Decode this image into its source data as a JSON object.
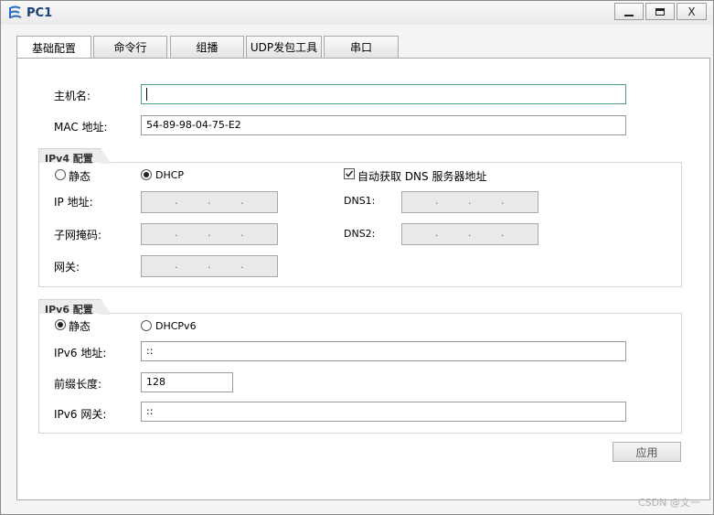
{
  "window": {
    "title": "PC1",
    "close_label": "X"
  },
  "tabs": [
    {
      "label": "基础配置"
    },
    {
      "label": "命令行"
    },
    {
      "label": "组播"
    },
    {
      "label": "UDP发包工具"
    },
    {
      "label": "串口"
    }
  ],
  "basic": {
    "hostname_label": "主机名:",
    "hostname_value": "",
    "mac_label": "MAC 地址:",
    "mac_value": "54-89-98-04-75-E2"
  },
  "ipv4": {
    "group_title": "IPv4 配置",
    "static_label": "静态",
    "dhcp_label": "DHCP",
    "auto_dns_label": "自动获取 DNS 服务器地址",
    "ip_label": "IP 地址:",
    "mask_label": "子网掩码:",
    "gateway_label": "网关:",
    "dns1_label": "DNS1:",
    "dns2_label": "DNS2:",
    "ip_dots": ".  .  .",
    "mode": "DHCP",
    "auto_dns_checked": true
  },
  "ipv6": {
    "group_title": "IPv6 配置",
    "static_label": "静态",
    "dhcp_label": "DHCPv6",
    "addr_label": "IPv6 地址:",
    "addr_value": "::",
    "prefix_label": "前缀长度:",
    "prefix_value": "128",
    "gateway_label": "IPv6 网关:",
    "gateway_value": "::",
    "mode": "静态"
  },
  "apply_label": "应用",
  "watermark": "CSDN @文一"
}
